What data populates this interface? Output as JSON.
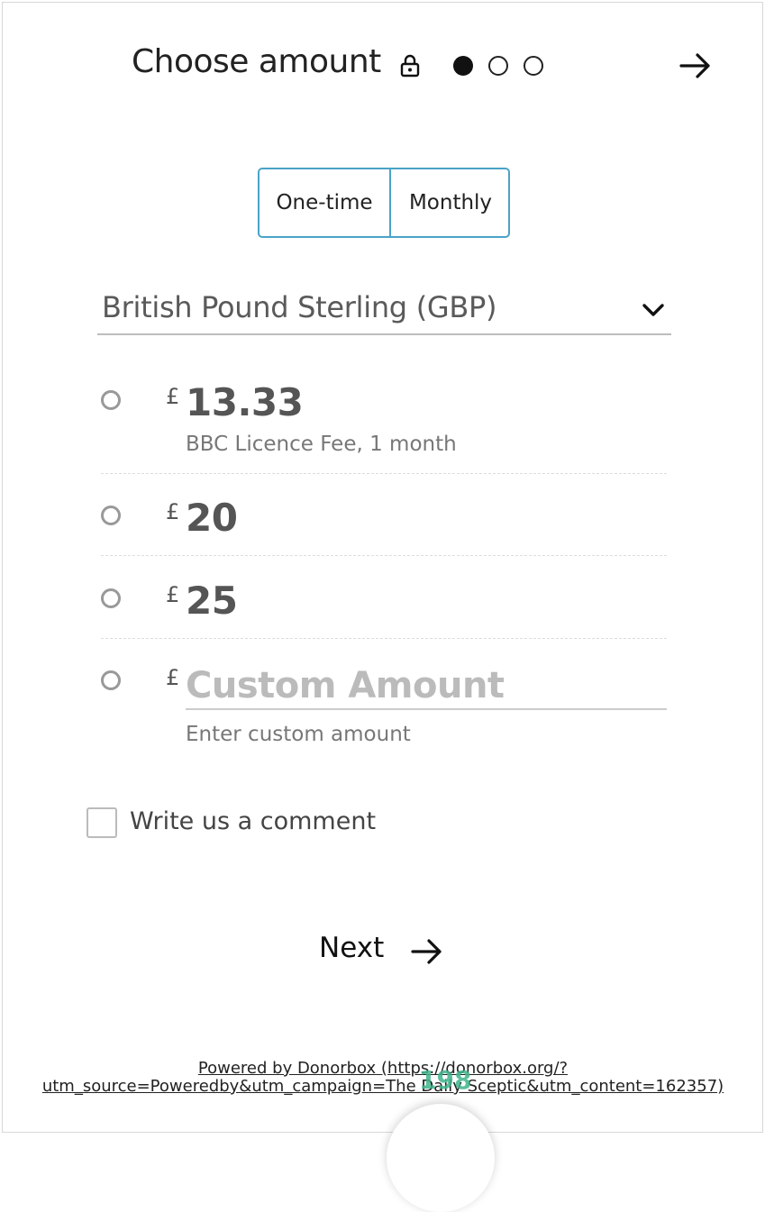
{
  "header": {
    "title": "Choose amount",
    "lock_icon": "lock-icon",
    "steps": {
      "total": 3,
      "current": 1
    },
    "next_icon": "arrow-right-icon"
  },
  "frequency": {
    "options": [
      "One-time",
      "Monthly"
    ]
  },
  "currency": {
    "selected": "British Pound Sterling (GBP)",
    "dropdown_icon": "chevron-down-icon"
  },
  "amounts": [
    {
      "symbol": "£",
      "value": "13.33",
      "description": "BBC Licence Fee, 1 month"
    },
    {
      "symbol": "£",
      "value": "20"
    },
    {
      "symbol": "£",
      "value": "25"
    }
  ],
  "custom": {
    "symbol": "£",
    "placeholder": "Custom Amount",
    "helper": "Enter custom amount"
  },
  "comment": {
    "label": "Write us a comment"
  },
  "next_button": {
    "label": "Next"
  },
  "footer": {
    "powered_line1": "Powered by Donorbox (https://donorbox.org/?",
    "powered_line2": "utm_source=Poweredby&utm_campaign=The Daily Sceptic&utm_content=162357)",
    "badge": "198"
  },
  "colors": {
    "accent": "#4aa3c7",
    "badge": "#3fb58a"
  }
}
